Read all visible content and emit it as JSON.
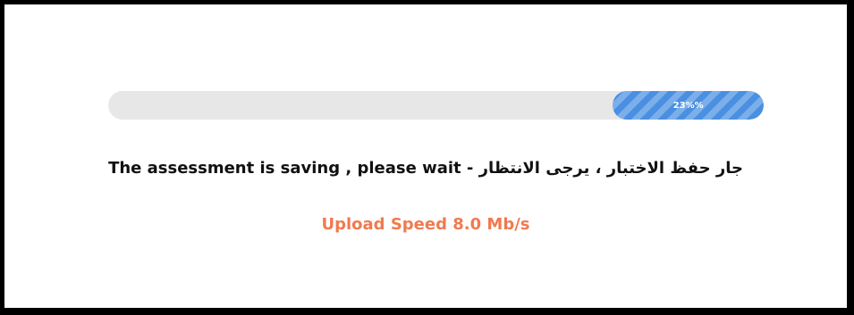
{
  "progress": {
    "label": "23%%",
    "fraction": 0.23,
    "track_color": "#e7e7e7",
    "fill_color": "#4a90e2"
  },
  "status": {
    "message": "The assessment is saving , please wait - جار حفظ الاختبار ، يرجى الانتظار",
    "upload_speed": "Upload Speed 8.0 Mb/s",
    "upload_speed_color": "#f07a4f"
  }
}
